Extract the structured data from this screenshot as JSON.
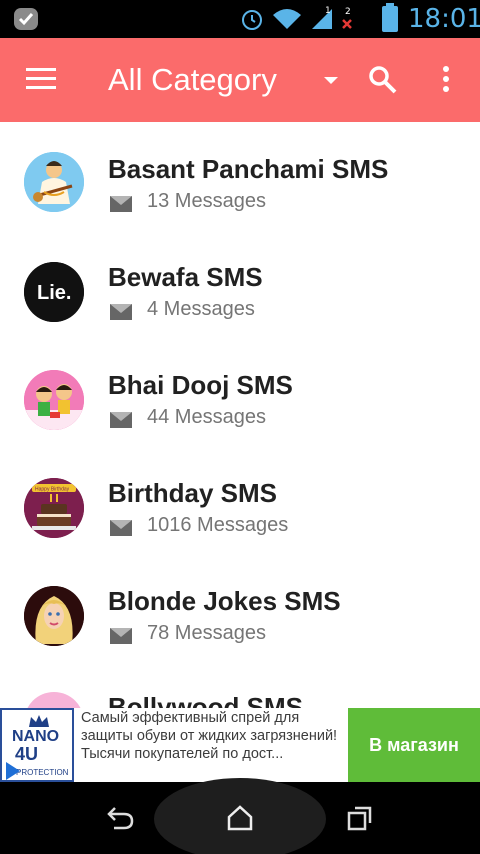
{
  "status_bar": {
    "time": "18:01",
    "signal_badge_1": "1",
    "signal_badge_2": "2"
  },
  "toolbar": {
    "title": "All Category"
  },
  "categories": [
    {
      "name": "Basant Panchami SMS",
      "count": "13 Messages",
      "avatar": "saraswati-avatar"
    },
    {
      "name": "Bewafa SMS",
      "count": "4 Messages",
      "avatar": "lie-avatar",
      "avatar_text": "Lie."
    },
    {
      "name": "Bhai Dooj SMS",
      "count": "44 Messages",
      "avatar": "siblings-avatar"
    },
    {
      "name": "Birthday SMS",
      "count": "1016 Messages",
      "avatar": "birthday-cake-avatar",
      "avatar_text": "Happy Birthday"
    },
    {
      "name": "Blonde Jokes SMS",
      "count": "78 Messages",
      "avatar": "blonde-avatar"
    },
    {
      "name": "Bollywood SMS",
      "count": "",
      "avatar": "bollywood-avatar"
    }
  ],
  "ad": {
    "logo_line1": "NANO",
    "logo_line2": "4U",
    "logo_line3": "PROTECTION",
    "text": "Самый эффективный спрей для защиты обуви от жидких загрязнений! Тысячи покупателей по дост...",
    "cta": "В магазин"
  },
  "colors": {
    "toolbar": "#fb6b6b",
    "ad_cta": "#5fbc39",
    "status_icons": "#5ab4e8"
  }
}
